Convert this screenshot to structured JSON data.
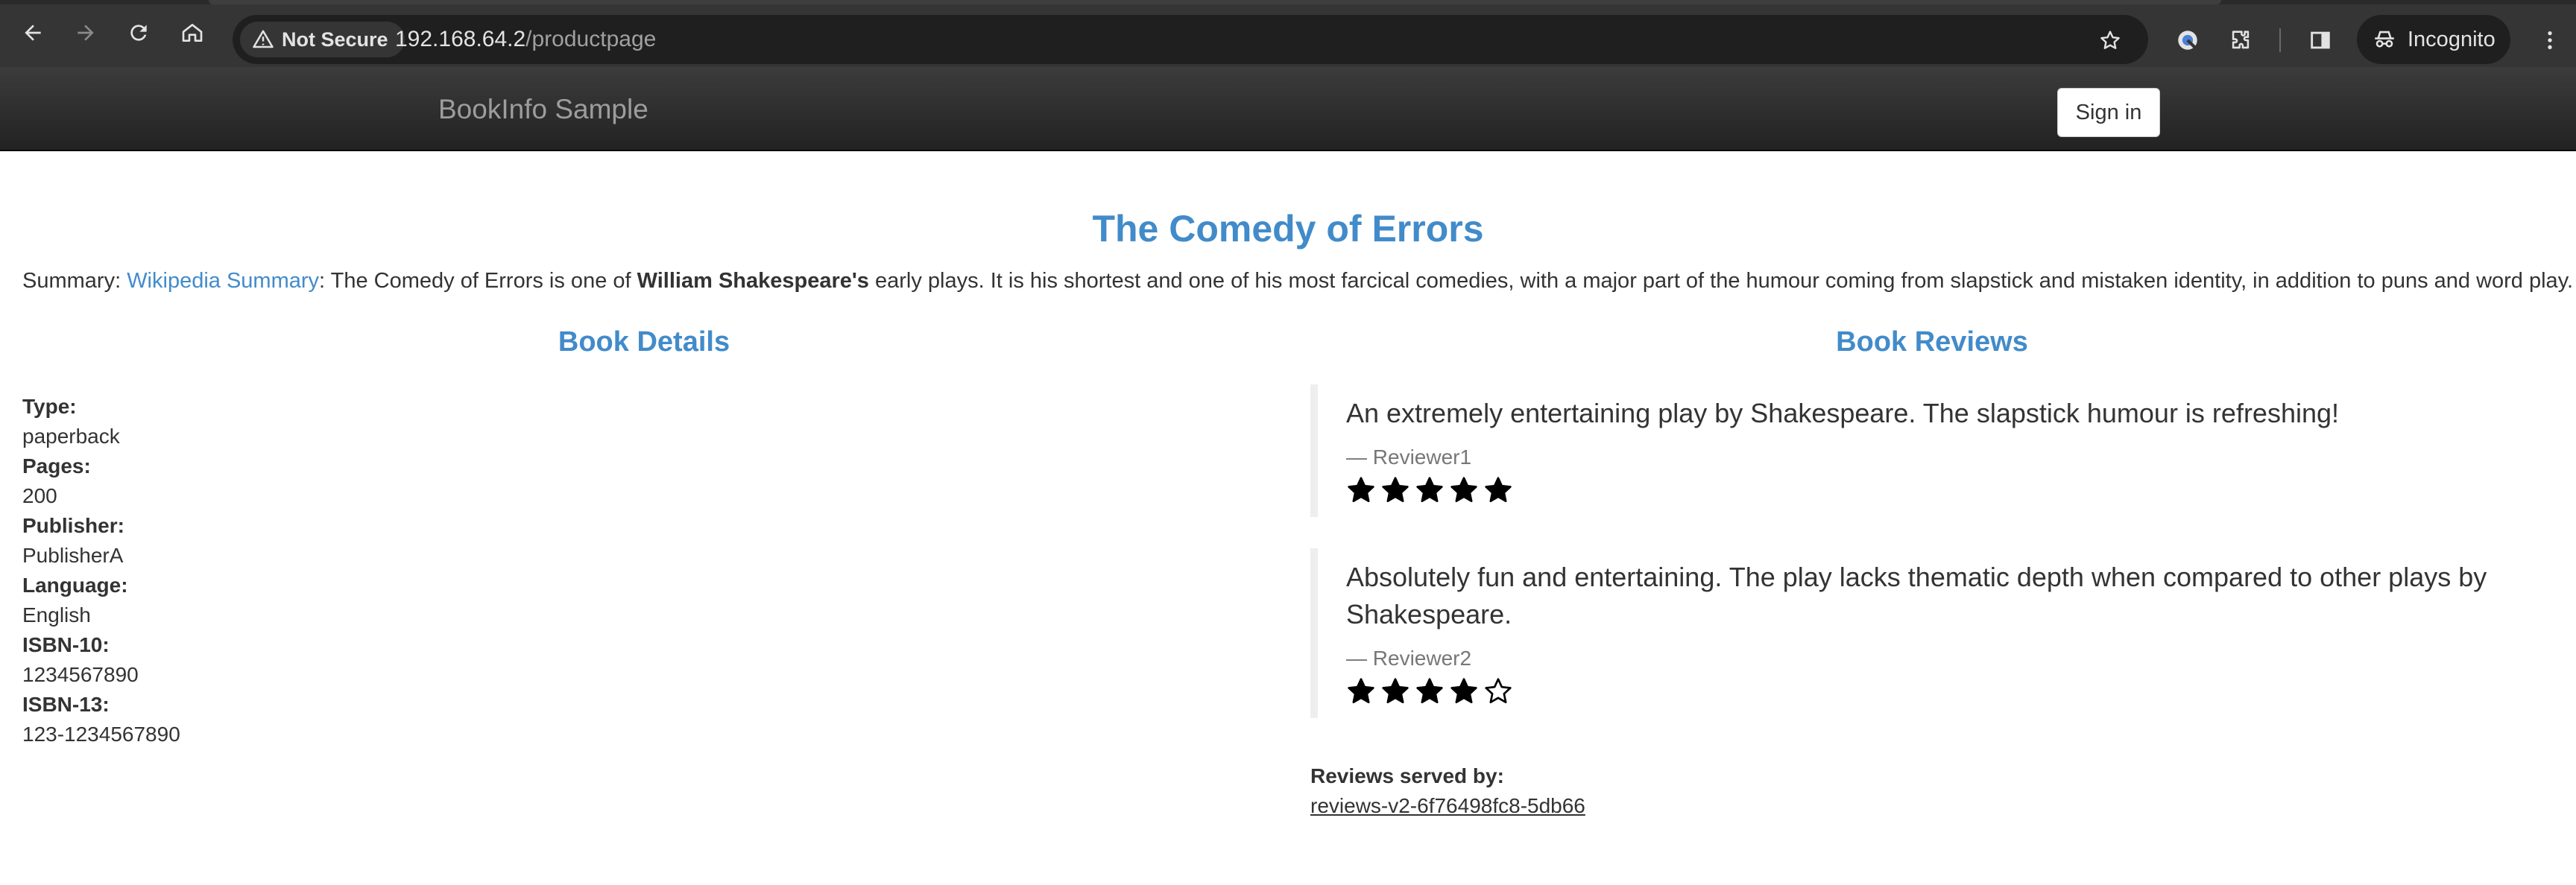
{
  "browser": {
    "security_label": "Not Secure",
    "url_host": "192.168.64.2",
    "url_path": "/productpage",
    "incognito_label": "Incognito"
  },
  "navbar": {
    "brand": "BookInfo Sample",
    "signin_label": "Sign in"
  },
  "product": {
    "title": "The Comedy of Errors",
    "summary_prefix": "Summary: ",
    "summary_link": "Wikipedia Summary",
    "summary_text_1": ": The Comedy of Errors is one of ",
    "summary_bold": "William Shakespeare's",
    "summary_text_2": " early plays. It is his shortest and one of his most farcical comedies, with a major part of the humour coming from slapstick and mistaken identity, in addition to puns and word play."
  },
  "details": {
    "heading": "Book Details",
    "items": [
      {
        "label": "Type:",
        "value": "paperback"
      },
      {
        "label": "Pages:",
        "value": "200"
      },
      {
        "label": "Publisher:",
        "value": "PublisherA"
      },
      {
        "label": "Language:",
        "value": "English"
      },
      {
        "label": "ISBN-10:",
        "value": "1234567890"
      },
      {
        "label": "ISBN-13:",
        "value": "123-1234567890"
      }
    ]
  },
  "reviews": {
    "heading": "Book Reviews",
    "items": [
      {
        "text": "An extremely entertaining play by Shakespeare. The slapstick humour is refreshing!",
        "author": "— Reviewer1",
        "rating": 5,
        "max_rating": 5
      },
      {
        "text": "Absolutely fun and entertaining. The play lacks thematic depth when compared to other plays by Shakespeare.",
        "author": "— Reviewer2",
        "rating": 4,
        "max_rating": 5
      }
    ],
    "served_label": "Reviews served by:",
    "served_pod": "reviews-v2-6f76498fc8-5db66"
  },
  "colors": {
    "accent": "#428bca",
    "star": "#000000"
  }
}
